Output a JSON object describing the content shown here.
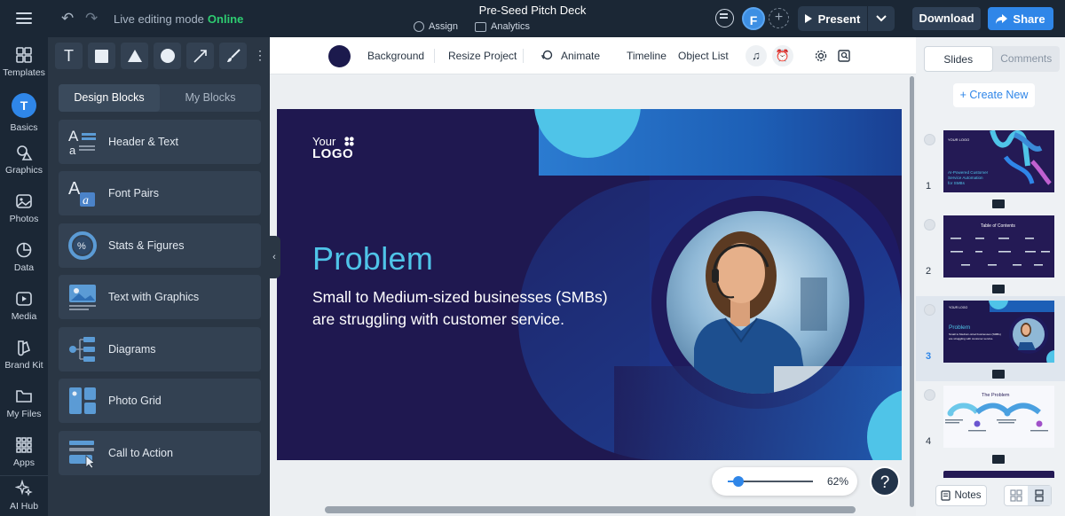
{
  "topbar": {
    "mode_label": "Live editing mode",
    "mode_status": "Online",
    "title": "Pre-Seed Pitch Deck",
    "assign_label": "Assign",
    "analytics_label": "Analytics",
    "avatar_initial": "F",
    "present_label": "Present",
    "download_label": "Download",
    "share_label": "Share"
  },
  "rail": {
    "items": [
      {
        "label": "Templates",
        "icon": "templates-icon"
      },
      {
        "label": "Basics",
        "icon": "basics-icon",
        "active": true
      },
      {
        "label": "Graphics",
        "icon": "graphics-icon"
      },
      {
        "label": "Photos",
        "icon": "photos-icon"
      },
      {
        "label": "Data",
        "icon": "data-icon"
      },
      {
        "label": "Media",
        "icon": "media-icon"
      },
      {
        "label": "Brand Kit",
        "icon": "brand-kit-icon"
      },
      {
        "label": "My Files",
        "icon": "folder-icon"
      },
      {
        "label": "Apps",
        "icon": "apps-icon"
      },
      {
        "label": "AI Hub",
        "icon": "ai-sparkle-icon"
      }
    ]
  },
  "panel": {
    "tools": [
      "text-tool",
      "square-tool",
      "triangle-tool",
      "circle-tool",
      "line-tool",
      "brush-tool"
    ],
    "tabs": [
      "Design Blocks",
      "My Blocks"
    ],
    "blocks": [
      {
        "label": "Header & Text"
      },
      {
        "label": "Font Pairs"
      },
      {
        "label": "Stats & Figures"
      },
      {
        "label": "Text with Graphics"
      },
      {
        "label": "Diagrams"
      },
      {
        "label": "Photo Grid"
      },
      {
        "label": "Call to Action"
      }
    ]
  },
  "canvas_toolbar": {
    "background_color": "#1c1a4d",
    "background_label": "Background",
    "resize_label": "Resize Project",
    "animate_label": "Animate",
    "timeline_label": "Timeline",
    "object_list_label": "Object List"
  },
  "slide": {
    "logo_top": "Your",
    "logo_bottom": "LOGO",
    "title": "Problem",
    "subtitle": "Small to Medium-sized businesses (SMBs) are struggling with customer service.",
    "bg_color": "#1f1850",
    "accent_color": "#4fc4e8"
  },
  "zoom": {
    "value": 62,
    "label": "62%"
  },
  "right_panel": {
    "tabs": [
      "Slides",
      "Comments"
    ],
    "create_label": "+ Create New",
    "thumbnails": [
      {
        "num": "1",
        "title": "AI-Powered Customer Service Automation for SMBs"
      },
      {
        "num": "2",
        "title": "Table of Contents"
      },
      {
        "num": "3",
        "title": "Problem",
        "active": true
      },
      {
        "num": "4",
        "title": "The Problem"
      }
    ],
    "notes_label": "Notes"
  }
}
